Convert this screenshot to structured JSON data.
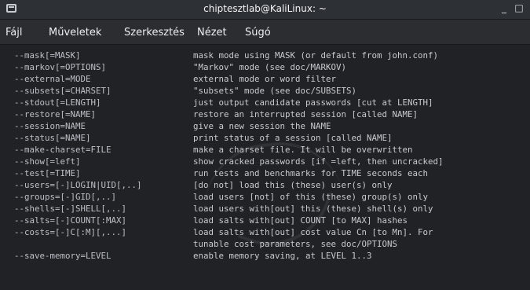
{
  "window": {
    "title": "chiptesztlab@KaliLinux: ~",
    "menu": [
      "Fájl",
      "Műveletek",
      "Szerkesztés",
      "Nézet",
      "Súgó"
    ],
    "controls": {
      "minimize": "_",
      "maximize": "□"
    }
  },
  "terminal": {
    "lines": [
      {
        "option": "--mask[=MASK]",
        "description": "mask mode using MASK (or default from john.conf)"
      },
      {
        "option": "--markov[=OPTIONS]",
        "description": "\"Markov\" mode (see doc/MARKOV)"
      },
      {
        "option": "--external=MODE",
        "description": "external mode or word filter"
      },
      {
        "option": "--subsets[=CHARSET]",
        "description": "\"subsets\" mode (see doc/SUBSETS)"
      },
      {
        "option": "--stdout[=LENGTH]",
        "description": "just output candidate passwords [cut at LENGTH]"
      },
      {
        "option": "--restore[=NAME]",
        "description": "restore an interrupted session [called NAME]"
      },
      {
        "option": "--session=NAME",
        "description": "give a new session the NAME"
      },
      {
        "option": "--status[=NAME]",
        "description": "print status of a session [called NAME]"
      },
      {
        "option": "--make-charset=FILE",
        "description": "make a charset file. It will be overwritten"
      },
      {
        "option": "--show[=left]",
        "description": "show cracked passwords [if =left, then uncracked]"
      },
      {
        "option": "--test[=TIME]",
        "description": "run tests and benchmarks for TIME seconds each"
      },
      {
        "option": "--users=[-]LOGIN|UID[,..]",
        "description": "[do not] load this (these) user(s) only"
      },
      {
        "option": "--groups=[-]GID[,..]",
        "description": "load users [not] of this (these) group(s) only"
      },
      {
        "option": "--shells=[-]SHELL[,..]",
        "description": "load users with[out] this (these) shell(s) only"
      },
      {
        "option": "--salts=[-]COUNT[:MAX]",
        "description": "load salts with[out] COUNT [to MAX] hashes"
      },
      {
        "option": "--costs=[-]C[:M][,...]",
        "description": "load salts with[out] cost value Cn [to Mn]. For"
      },
      {
        "option": "",
        "description": "tunable cost parameters, see doc/OPTIONS"
      },
      {
        "option": "--save-memory=LEVEL",
        "description": "enable memory saving, at LEVEL 1..3"
      }
    ]
  }
}
